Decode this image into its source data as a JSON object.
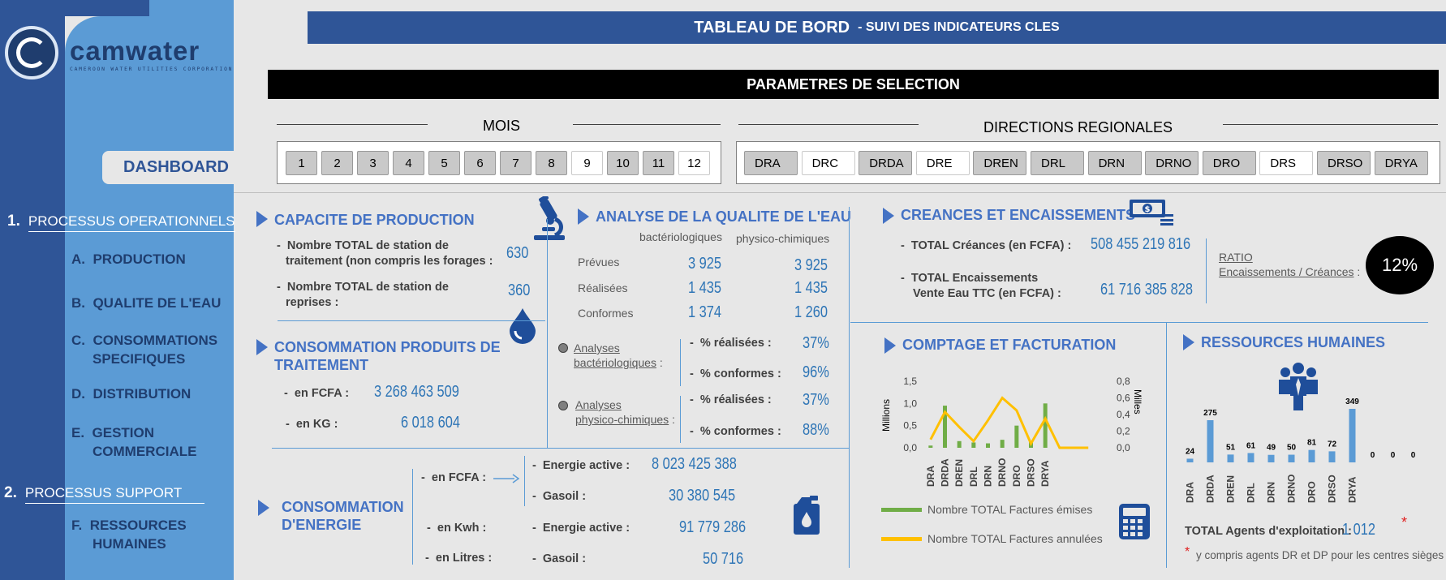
{
  "logo": {
    "name": "camwater",
    "tagline": "CAMEROON  WATER  UTILITIES  CORPORATION"
  },
  "sidebar": {
    "dashboard_label": "DASHBOARD",
    "section1": {
      "num": "1.",
      "label": "PROCESSUS OPERATIONNELS"
    },
    "items1": [
      {
        "letter": "A.",
        "label": "PRODUCTION"
      },
      {
        "letter": "B.",
        "label": "QUALITE DE L'EAU"
      },
      {
        "letter": "C.",
        "label": "CONSOMMATIONS",
        "label2": "SPECIFIQUES"
      },
      {
        "letter": "D.",
        "label": "DISTRIBUTION"
      },
      {
        "letter": "E.",
        "label": "GESTION",
        "label2": "COMMERCIALE"
      }
    ],
    "section2": {
      "num": "2.",
      "label": "PROCESSUS SUPPORT"
    },
    "items2": [
      {
        "letter": "F.",
        "label": "RESSOURCES",
        "label2": "HUMAINES"
      }
    ]
  },
  "header": {
    "title": "TABLEAU DE BORD",
    "subtitle": "-  SUIVI DES INDICATEURS CLES"
  },
  "selection": {
    "title": "PARAMETRES DE SELECTION",
    "months_label": "MOIS",
    "months": [
      {
        "label": "1",
        "selected": false
      },
      {
        "label": "2",
        "selected": false
      },
      {
        "label": "3",
        "selected": false
      },
      {
        "label": "4",
        "selected": false
      },
      {
        "label": "5",
        "selected": false
      },
      {
        "label": "6",
        "selected": false
      },
      {
        "label": "7",
        "selected": false
      },
      {
        "label": "8",
        "selected": false
      },
      {
        "label": "9",
        "selected": true
      },
      {
        "label": "10",
        "selected": false
      },
      {
        "label": "11",
        "selected": false
      },
      {
        "label": "12",
        "selected": true
      }
    ],
    "regions_label": "DIRECTIONS REGIONALES",
    "regions": [
      {
        "label": "DRA",
        "selected": false
      },
      {
        "label": "DRC",
        "selected": true
      },
      {
        "label": "DRDA",
        "selected": false
      },
      {
        "label": "DRE",
        "selected": true
      },
      {
        "label": "DREN",
        "selected": false
      },
      {
        "label": "DRL",
        "selected": false
      },
      {
        "label": "DRN",
        "selected": false
      },
      {
        "label": "DRNO",
        "selected": false
      },
      {
        "label": "DRO",
        "selected": false
      },
      {
        "label": "DRS",
        "selected": true
      },
      {
        "label": "DRSO",
        "selected": false
      },
      {
        "label": "DRYA",
        "selected": false
      }
    ]
  },
  "production": {
    "title": "CAPACITE  DE PRODUCTION",
    "row1_label_a": "Nombre TOTAL de station de",
    "row1_label_b": "traitement (non compris les forages :",
    "row1_value": "630",
    "row2_label_a": "Nombre TOTAL de station de",
    "row2_label_b": "reprises :",
    "row2_value": "360",
    "icons": {
      "top": "microscope-icon",
      "bottom": "water-drop-icon"
    }
  },
  "produits": {
    "title_a": "CONSOMMATION PRODUITS DE",
    "title_b": "TRAITEMENT",
    "fcfa_label": "en FCFA :",
    "fcfa_value": "3 268 463 509",
    "kg_label": "en KG :",
    "kg_value": "6 018 604"
  },
  "qualite": {
    "title": "ANALYSE DE LA QUALITE DE L'EAU",
    "col1": "bactériologiques",
    "col2": "physico-chimiques",
    "rows": [
      {
        "label": "Prévues",
        "v1": "3 925",
        "v2": "3 925"
      },
      {
        "label": "Réalisées",
        "v1": "1 435",
        "v2": "1 435"
      },
      {
        "label": "Conformes",
        "v1": "1 374",
        "v2": "1 260"
      }
    ],
    "bact_label_a": "Analyses",
    "bact_label_b": "bactériologiques",
    "pc_label_a": "Analyses",
    "pc_label_b": "physico-chimiques",
    "pct_real_label": "% réalisées :",
    "pct_conf_label": "% conformes :",
    "bact_real": "37%",
    "bact_conf": "96%",
    "pc_real": "37%",
    "pc_conf": "88%"
  },
  "energie": {
    "title_a": "CONSOMMATION",
    "title_b": "D'ENERGIE",
    "fcfa_label": "en FCFA :",
    "kwh_label": "en Kwh :",
    "litres_label": "en Litres :",
    "active_label": "Energie active :",
    "gasoil_label": "Gasoil :",
    "fcfa_active": "8 023 425 388",
    "fcfa_gasoil": "30 380 545",
    "kwh_active": "91 779 286",
    "litres_gasoil": "50 716",
    "icon": "fuel-can-icon"
  },
  "creances": {
    "title": "CREANCES ET ENCAISSEMENTS",
    "total_label": "TOTAL Créances (en FCFA) :",
    "total_value": "508 455 219 816",
    "enc_label_a": "TOTAL Encaissements",
    "enc_label_b": "Vente Eau TTC (en FCFA) :",
    "enc_value": "61 716 385 828",
    "ratio_label": "RATIO",
    "ratio_sub": "Encaissements / Créances",
    "ratio_value": "12%",
    "icon": "money-icon"
  },
  "comptage": {
    "title": "COMPTAGE ET FACTURATION",
    "left_axis_title": "Millions",
    "right_axis_title": "Milles",
    "legend_emises": "Nombre TOTAL Factures émises",
    "legend_annulees": "Nombre TOTAL Factures annulées",
    "icon": "calculator-icon"
  },
  "rh": {
    "title": "RESSOURCES HUMAINES",
    "total_label": "TOTAL Agents d'exploitation :",
    "total_value": "1 012",
    "asterisk": "*",
    "footnote": "y compris agents  DR et DP pour les centres sièges",
    "icon": "team-icon"
  },
  "chart_data": [
    {
      "type": "line",
      "categories": [
        "DRA",
        "DRDA",
        "DREN",
        "DRL",
        "DRN",
        "DRNO",
        "DRO",
        "DRSO",
        "DRYA",
        "",
        "",
        ""
      ],
      "series": [
        {
          "name": "Nombre TOTAL Factures émises",
          "axis": "left",
          "values": [
            0.05,
            0.95,
            0.15,
            0.12,
            0.1,
            0.18,
            0.5,
            0.15,
            1.0,
            0,
            0,
            0
          ],
          "color": "#70ad47"
        },
        {
          "name": "Nombre TOTAL Factures annulées",
          "axis": "right",
          "values": [
            0.1,
            0.43,
            0.25,
            0.08,
            0.33,
            0.6,
            0.45,
            0.05,
            0.35,
            0,
            0,
            0
          ],
          "color": "#ffc000"
        }
      ],
      "ylim_left": [
        0,
        1.5
      ],
      "yticks_left": [
        "0,0",
        "0,5",
        "1,0",
        "1,5"
      ],
      "ylim_right": [
        0,
        0.8
      ],
      "yticks_right": [
        "0,0",
        "0,2",
        "0,4",
        "0,6",
        "0,8"
      ],
      "ylabel_left": "Millions",
      "ylabel_right": "Milles"
    },
    {
      "type": "bar",
      "categories": [
        "DRA",
        "DRDA",
        "DREN",
        "DRL",
        "DRN",
        "DRNO",
        "DRO",
        "DRSO",
        "DRYA",
        "",
        "",
        ""
      ],
      "values": [
        24,
        275,
        51,
        61,
        49,
        50,
        81,
        72,
        349,
        0,
        0,
        0
      ],
      "color": "#5b9bd5"
    }
  ]
}
